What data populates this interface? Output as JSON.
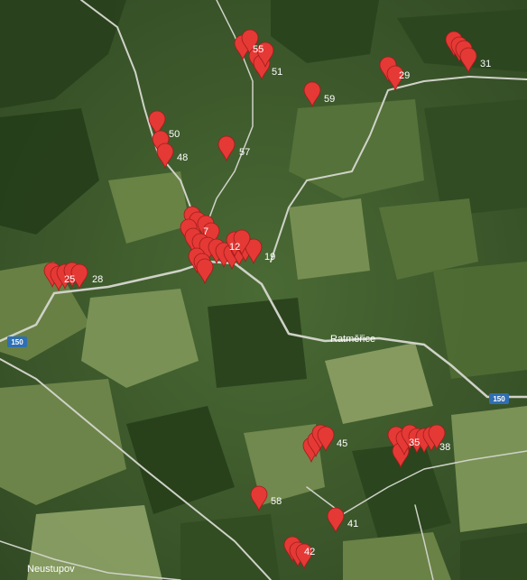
{
  "map": {
    "places": [
      {
        "name": "Ratměřice"
      },
      {
        "name": "Neustupov"
      }
    ],
    "road_shields": [
      "150",
      "150"
    ],
    "marker_color": "#e53935",
    "road_color": "#cfd2c8",
    "labels": [
      "55",
      "51",
      "29",
      "31",
      "59",
      "50",
      "48",
      "57",
      "7",
      "12",
      "19",
      "25",
      "28",
      "45",
      "35",
      "38",
      "58",
      "41",
      "42"
    ]
  }
}
